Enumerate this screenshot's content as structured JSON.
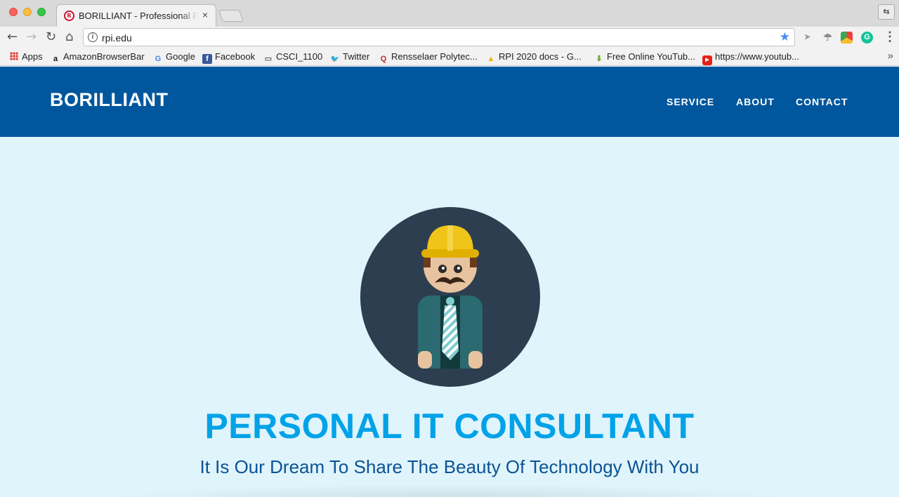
{
  "browser": {
    "tab_title": "BORILLIANT - Professional Pe",
    "tab_close": "×",
    "favicon_letter": "RPI",
    "profile_label": "⇆",
    "url": "rpi.edu",
    "bookmarks": [
      {
        "label": "Apps",
        "icon": "apps-grid-icon"
      },
      {
        "label": "AmazonBrowserBar",
        "icon": "amazon-icon",
        "glyph": "a"
      },
      {
        "label": "Google",
        "icon": "google-icon",
        "glyph": "G"
      },
      {
        "label": "Facebook",
        "icon": "facebook-icon",
        "glyph": "f"
      },
      {
        "label": "CSCI_1100",
        "icon": "folder-icon",
        "glyph": "▭"
      },
      {
        "label": "Twitter",
        "icon": "twitter-icon",
        "glyph": "🐦"
      },
      {
        "label": "Rensselaer Polytec...",
        "icon": "quora-icon",
        "glyph": "Q"
      },
      {
        "label": "RPI 2020 docs - G...",
        "icon": "google-drive-icon",
        "glyph": "▲"
      },
      {
        "label": "Free Online YouTub...",
        "icon": "download-arrow-icon",
        "glyph": "⬇"
      },
      {
        "label": "https://www.youtub...",
        "icon": "youtube-icon",
        "glyph": "▶"
      }
    ],
    "bookmarks_overflow": "»",
    "colors": {
      "accent": "#4a8de8"
    }
  },
  "site": {
    "brand": "BORILLIANT",
    "nav": {
      "service": "SERVICE",
      "about": "ABOUT",
      "contact": "CONTACT"
    },
    "hero": {
      "title": "PERSONAL IT CONSULTANT",
      "subtitle": "It Is Our Dream To Share The Beauty Of Technology With You",
      "illustration": "consultant-avatar-hardhat"
    },
    "colors": {
      "header_bg": "#00579d",
      "hero_bg": "#dff4fb",
      "title": "#00a2e8",
      "subtitle": "#0b5394",
      "avatar_circle": "#2d3e50"
    }
  }
}
